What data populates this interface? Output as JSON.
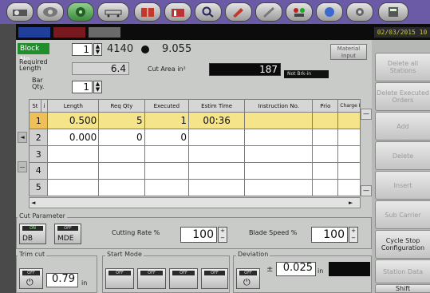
{
  "toolbar": {
    "icons": [
      "home-icon",
      "tape-icon",
      "cutter-icon",
      "conveyor-icon",
      "book-icon",
      "folder-icon",
      "search-icon",
      "tools-icon",
      "edit-icon",
      "network-icon",
      "color-icon",
      "settings-icon",
      "calculator-icon"
    ]
  },
  "status": {
    "datetime": "02/03/2015 10",
    "colors": [
      "#1f3f9a",
      "#7a1820",
      "#6a6a6a"
    ]
  },
  "header": {
    "block_no_label": "Block No.",
    "block_no_value": "1",
    "part": "4140",
    "diameter": "9.055",
    "material_input_label": "Material Input",
    "required_length_label": "Required Length",
    "required_length_value": "6.4",
    "cut_area_label": "Cut Area in²",
    "cut_area_value": "187",
    "not_brk_label": "Not Brk-in",
    "bar_qty_label": "Bar Qty.",
    "bar_qty_value": "1"
  },
  "table": {
    "headers": [
      "St",
      "i",
      "Length",
      "Req Qty",
      "Executed",
      "Estim Time",
      "Instruction No.",
      "Prio",
      "Charge Length"
    ],
    "rows": [
      {
        "num": "1",
        "length": "0.500",
        "req_qty": "5",
        "executed": "1",
        "estim": "00:36"
      },
      {
        "num": "2",
        "length": "0.000",
        "req_qty": "0",
        "executed": "0",
        "estim": ""
      },
      {
        "num": "3",
        "length": "",
        "req_qty": "",
        "executed": "",
        "estim": ""
      },
      {
        "num": "4",
        "length": "",
        "req_qty": "",
        "executed": "",
        "estim": ""
      },
      {
        "num": "5",
        "length": "",
        "req_qty": "",
        "executed": "",
        "estim": ""
      }
    ]
  },
  "cut_parameter": {
    "title": "Cut Parameter",
    "db_on": "ON",
    "db_label": "DB",
    "mde_label": "MDE",
    "mde_badge": "OFF",
    "cutting_rate_label": "Cutting Rate %",
    "cutting_rate_value": "100",
    "blade_speed_label": "Blade Speed %",
    "blade_speed_value": "100"
  },
  "trim_cut": {
    "title": "Trim cut",
    "off": "OFF",
    "value": "0.79",
    "unit": "in"
  },
  "start_mode": {
    "title": "Start Mode",
    "off": "OFF"
  },
  "deviation": {
    "title": "Deviation",
    "off": "OFF",
    "pm": "±",
    "value": "0.025",
    "unit": "in"
  },
  "right_panel": {
    "buttons": [
      "Delete all Stations",
      "Delete Executed Orders",
      "Add",
      "Delete",
      "Insert",
      "Sub Carrier",
      "Cycle Stop Configuration",
      "Station Data",
      "Shift"
    ]
  }
}
